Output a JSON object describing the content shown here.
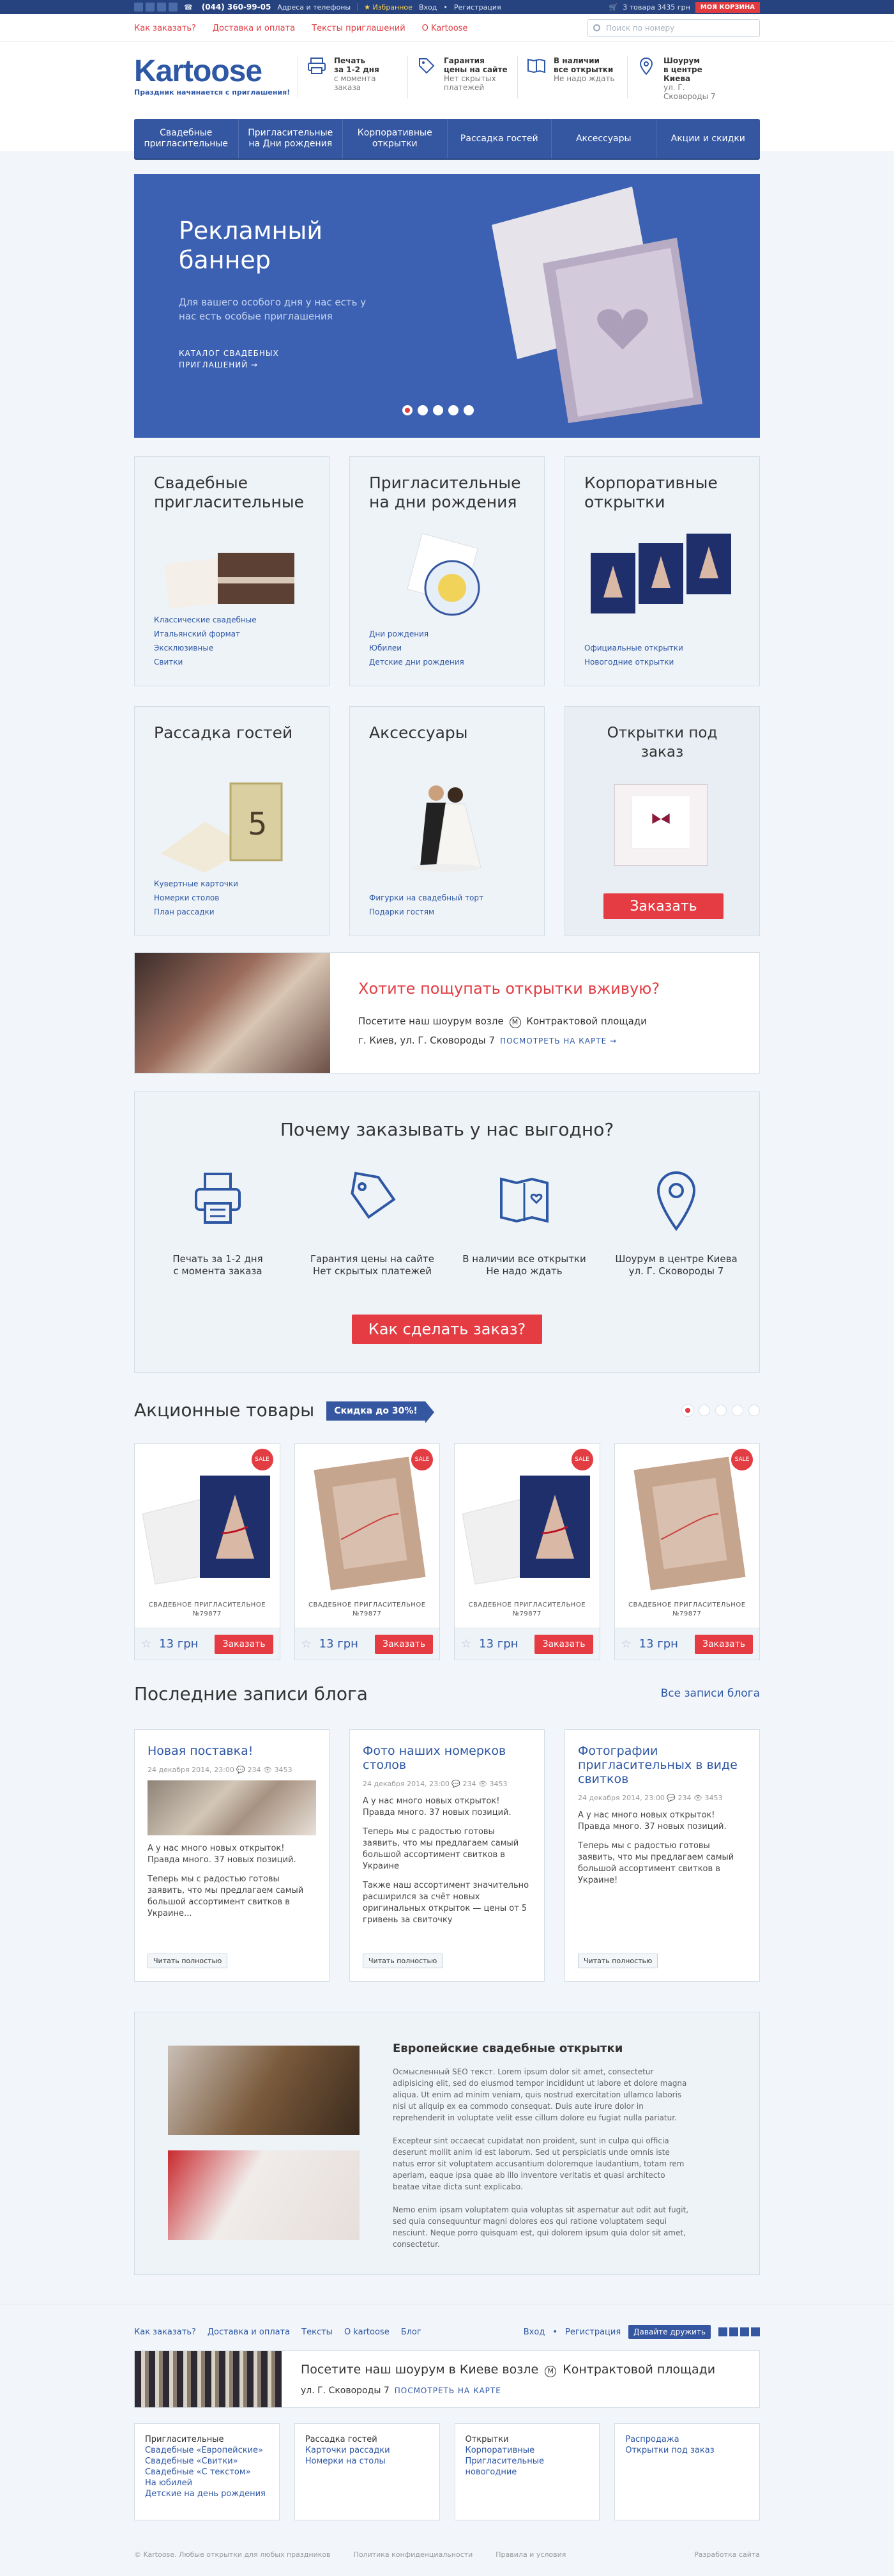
{
  "topbar": {
    "phone": "(044) 360-99-05",
    "phone_link": "Адреса и телефоны",
    "fav": "★ Избранное",
    "login": "Вход",
    "register": "Регистрация",
    "cart_info": "3 товара  3435 грн",
    "cart_btn": "МОЯ КОРЗИНА"
  },
  "subbar": {
    "links": [
      "Как заказать?",
      "Доставка и оплата",
      "Тексты приглашений",
      "О Kartoose"
    ],
    "search_placeholder": "Поиск по номеру"
  },
  "logo": {
    "title": "Kartoose",
    "slogan": "Праздник начинается с приглашения!"
  },
  "features": [
    {
      "t1": "Печать",
      "t2": "за 1-2 дня",
      "t3": "с момента",
      "t4": "заказа"
    },
    {
      "t1": "Гарантия",
      "t2": "цены на сайте",
      "t3": "Нет скрытых",
      "t4": "платежей"
    },
    {
      "t1": "В наличии",
      "t2": "все открытки",
      "t3": "Не надо ждать",
      "t4": ""
    },
    {
      "t1": "Шоурум",
      "t2": "в центре Киева",
      "t3": "ул. Г. Сковороды 7",
      "t4": ""
    }
  ],
  "menu": [
    "Свадебные пригласительные",
    "Пригласительные на Дни рождения",
    "Корпоративные открытки",
    "Рассадка гостей",
    "Аксессуары",
    "Акции и скидки"
  ],
  "banner": {
    "title1": "Рекламный",
    "title2": "баннер",
    "sub": "Для вашего особого дня у нас есть у нас есть особые приглашения",
    "cat1": "КАТАЛОГ СВАДЕБНЫХ",
    "cat2": "ПРИГЛАШЕНИЙ →"
  },
  "cards": [
    {
      "title": "Свадебные пригласительные",
      "links": [
        "Классические свадебные",
        "Итальянский формат",
        "Эксклюзивные",
        "Свитки"
      ]
    },
    {
      "title": "Пригласительные на дни рождения",
      "links": [
        "Дни рождения",
        "Юбилеи",
        "Детские дни рождения"
      ]
    },
    {
      "title": "Корпоративные открытки",
      "links": [
        "Официальные открытки",
        "Новогодние открытки"
      ]
    },
    {
      "title": "Рассадка гостей",
      "links": [
        "Кувертные карточки",
        "Номерки столов",
        "План рассадки"
      ]
    },
    {
      "title": "Аксессуары",
      "links": [
        "Фигурки на свадебный торт",
        "Подарки гостям"
      ]
    },
    {
      "title": "Открытки под заказ",
      "button": "Заказать"
    }
  ],
  "showroom": {
    "title": "Хотите пощупать открытки вживую?",
    "p1a": "Посетите наш шоурум возле",
    "metro": "М",
    "p1b": "Контрактовой площади",
    "p2": "г. Киев, ул. Г. Сковороды 7",
    "map": "ПОСМОТРЕТЬ НА КАРТЕ →"
  },
  "why": {
    "title": "Почему заказывать у нас выгодно?",
    "items": [
      {
        "l1": "Печать за 1-2 дня",
        "l2": "с момента заказа"
      },
      {
        "l1": "Гарантия цены на сайте",
        "l2": "Нет скрытых платежей"
      },
      {
        "l1": "В наличии все открытки",
        "l2": "Не надо ждать"
      },
      {
        "l1": "Шоурум в центре Киева",
        "l2": "ул. Г. Сковороды 7"
      }
    ],
    "button": "Как сделать заказ?"
  },
  "promo": {
    "title": "Акционные товары",
    "tag": "Скидка до 30%!",
    "products": [
      {
        "sale": "SALE",
        "name1": "СВАДЕБНОЕ ПРИГЛАСИТЕЛЬНОЕ",
        "name2": "№79877",
        "price": "13 грн",
        "buy": "Заказать"
      },
      {
        "sale": "SALE",
        "name1": "СВАДЕБНОЕ ПРИГЛАСИТЕЛЬНОЕ",
        "name2": "№79877",
        "price": "13 грн",
        "buy": "Заказать"
      },
      {
        "sale": "SALE",
        "name1": "СВАДЕБНОЕ ПРИГЛАСИТЕЛЬНОЕ",
        "name2": "№79877",
        "price": "13 грн",
        "buy": "Заказать"
      },
      {
        "sale": "SALE",
        "name1": "СВАДЕБНОЕ ПРИГЛАСИТЕЛЬНОЕ",
        "name2": "№79877",
        "price": "13 грн",
        "buy": "Заказать"
      }
    ]
  },
  "blog": {
    "title": "Последние записи блога",
    "all": "Все записи блога",
    "posts": [
      {
        "title": "Новая поставка!",
        "meta": "24 декабря 2014, 23:00   💬 234   👁 3453",
        "p1": "А у нас много новых открыток! Правда много. 37 новых позиций.",
        "p2": "Теперь мы с радостью готовы заявить, что мы предлагаем самый большой ассортимент свитков в Украине...",
        "more": "Читать полностью"
      },
      {
        "title": "Фото наших номерков столов",
        "meta": "24 декабря 2014, 23:00   💬 234   👁 3453",
        "p1": "А у нас много новых открыток! Правда много. 37 новых позиций.",
        "p2": "Теперь мы с радостью готовы заявить, что мы предлагаем самый большой ассортимент свитков в Украине",
        "p3": "Также наш ассортимент значительно расширился за счёт новых оригинальных открыток — цены от 5 гривень за свиточку",
        "more": "Читать полностью"
      },
      {
        "title": "Фотографии пригласительных в виде свитков",
        "meta": "24 декабря 2014, 23:00   💬 234   👁 3453",
        "p1": "А у нас много новых открыток! Правда много. 37 новых позиций.",
        "p2": "Теперь мы с радостью готовы заявить, что мы предлагаем самый большой ассортимент свитков в Украине!",
        "more": "Читать полностью"
      }
    ]
  },
  "seo": {
    "title": "Европейские свадебные открытки",
    "p1": "Осмысленный SEO текст. Lorem ipsum dolor sit amet, consectetur adipisicing elit, sed do eiusmod tempor incididunt ut labore et dolore magna aliqua. Ut enim ad minim veniam, quis nostrud exercitation ullamco laboris nisi ut aliquip ex ea commodo consequat. Duis aute irure dolor in reprehenderit in voluptate velit esse cillum dolore eu fugiat nulla pariatur.",
    "p2": "Excepteur sint occaecat cupidatat non proident, sunt in culpa qui officia deserunt mollit anim id est laborum. Sed ut perspiciatis unde omnis iste natus error sit voluptatem accusantium doloremque laudantium, totam rem aperiam, eaque ipsa quae ab illo inventore veritatis et quasi architecto beatae vitae dicta sunt explicabo.",
    "p3": "Nemo enim ipsam voluptatem quia voluptas sit aspernatur aut odit aut fugit, sed quia consequuntur magni dolores eos qui ratione voluptatem sequi nesciunt. Neque porro quisquam est, qui dolorem ipsum quia dolor sit amet, consectetur."
  },
  "footer": {
    "links": [
      "Как заказать?",
      "Доставка и оплата",
      "Тексты",
      "О kartoose",
      "Блог"
    ],
    "login": "Вход",
    "register": "Регистрация",
    "subscribe": "Давайте дружить",
    "show1a": "Посетите наш шоурум в Киеве возле",
    "metro": "М",
    "show1b": "Контрактовой площади",
    "show2": "ул. Г. Сковороды 7",
    "map": "ПОСМОТРЕТЬ НА КАРТЕ",
    "cols": [
      {
        "h": "Пригласительные",
        "items": [
          "Свадебные «Европейские»",
          "Свадебные «Свитки»",
          "Свадебные «С текстом»",
          "На юбилей",
          "Детские на день рождения"
        ]
      },
      {
        "h": "Рассадка гостей",
        "items": [
          "Карточки рассадки",
          "Номерки на столы"
        ]
      },
      {
        "h": "Открытки",
        "items": [
          "Корпоративные",
          "Пригласительные новогодние"
        ]
      },
      {
        "h": "Распродажа",
        "items": [
          "Открытки под заказ"
        ]
      }
    ],
    "copy": "© Kartoose. Любые открытки для любых праздников",
    "privacy": "Политика конфиденциальности",
    "terms": "Правила и условия",
    "dev": "Разработка сайта"
  }
}
